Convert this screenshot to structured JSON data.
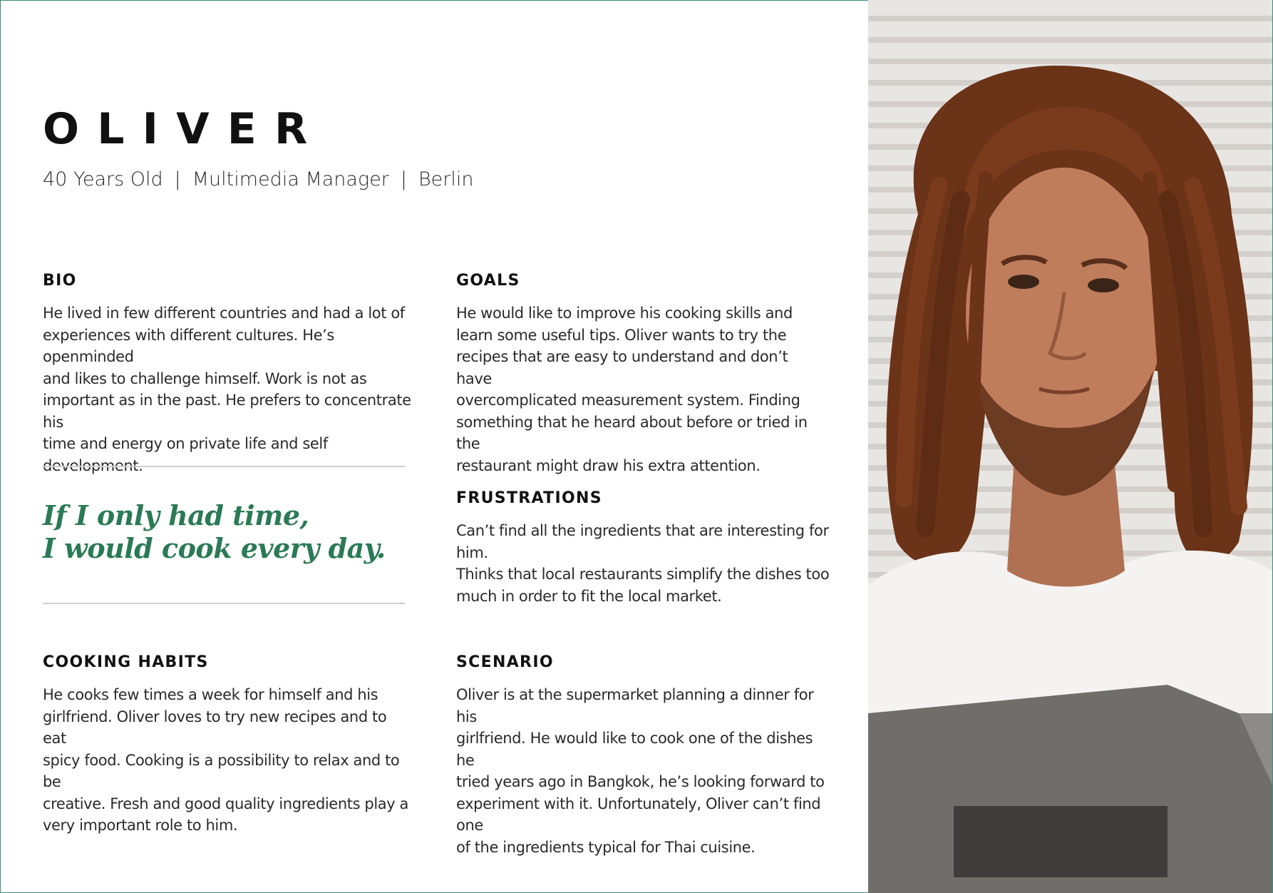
{
  "persona": {
    "name": "OLIVER",
    "age": "40 Years Old",
    "separator": "|",
    "occupation": "Multimedia Manager",
    "location": "Berlin"
  },
  "bio": {
    "heading": "BIO",
    "lines": [
      "He lived in few different countries and had a lot of",
      "experiences with different cultures. He’s openminded",
      "and likes to challenge himself. Work is not as",
      "important as in the past. He prefers to concentrate his",
      "time and energy on private life and self development."
    ]
  },
  "goals": {
    "heading": "GOALS",
    "lines": [
      "He would like to improve his cooking skills and",
      "learn some useful tips. Oliver wants to try the",
      "recipes that are easy to understand and don’t have",
      "overcomplicated measurement system. Finding",
      "something that he heard about before or tried in the",
      "restaurant might draw his extra attention."
    ]
  },
  "quote": {
    "line1": "If I only had time,",
    "line2": "I would cook every day."
  },
  "frustrations": {
    "heading": "FRUSTRATIONS",
    "lines": [
      "Can’t find all the ingredients that are interesting for him.",
      "Thinks that local restaurants simplify the dishes too",
      "much in order to fit the local market."
    ]
  },
  "cooking_habits": {
    "heading": "COOKING HABITS",
    "lines": [
      "He cooks few times a week for himself and his",
      "girlfriend. Oliver loves to try new recipes and to eat",
      "spicy food. Cooking is a possibility to relax and to be",
      "creative. Fresh and good quality ingredients play a",
      "very important role to him."
    ]
  },
  "scenario": {
    "heading": "SCENARIO",
    "lines": [
      "Oliver is at the supermarket planning a dinner for his",
      "girlfriend. He would like to cook one of the dishes he",
      "tried years ago in Bangkok, he’s looking forward to",
      "experiment with it. Unfortunately, Oliver can’t find one",
      "of the ingredients typical for Thai cuisine."
    ]
  },
  "colors": {
    "quote": "#2a7a55",
    "rule": "#cfcfcf",
    "frame": "#3f8a80"
  }
}
